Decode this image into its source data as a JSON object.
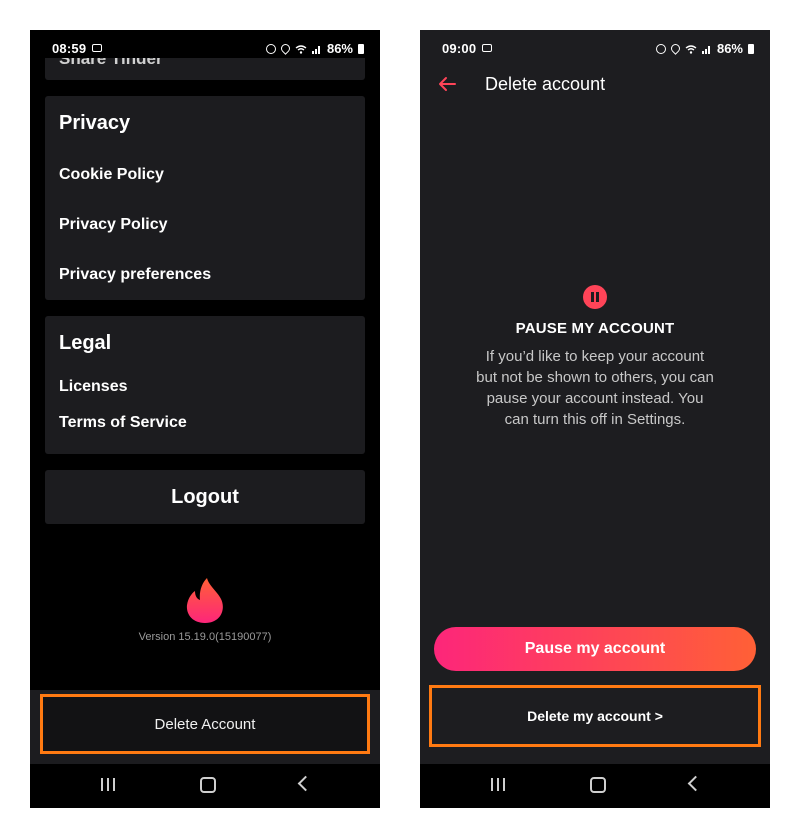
{
  "left": {
    "status": {
      "time": "08:59",
      "battery": "86%"
    },
    "share_partial": "Share Tinder",
    "privacy": {
      "title": "Privacy",
      "items": [
        "Cookie Policy",
        "Privacy Policy",
        "Privacy preferences"
      ]
    },
    "legal": {
      "title": "Legal",
      "items": [
        "Licenses",
        "Terms of Service"
      ]
    },
    "logout_label": "Logout",
    "version": "Version 15.19.0(15190077)",
    "delete_account_label": "Delete Account"
  },
  "right": {
    "status": {
      "time": "09:00",
      "battery": "86%"
    },
    "header_title": "Delete account",
    "pause_heading": "PAUSE MY ACCOUNT",
    "pause_body": "If you’d like to keep your account but not be shown to others, you can pause your account instead. You can turn this off in Settings.",
    "pause_button_label": "Pause my account",
    "delete_button_label": "Delete my account >"
  },
  "colors": {
    "accent_orange": "#ff7a12",
    "brand_pink": "#fd267a",
    "brand_orange": "#ff6036",
    "brand_red": "#ff4458"
  },
  "icons": [
    "image-icon",
    "alarm-icon",
    "location-icon",
    "wifi-icon",
    "signal-icon",
    "battery-icon",
    "flame-logo",
    "back-arrow-icon",
    "pause-icon",
    "recents-icon",
    "home-icon",
    "nav-back-icon"
  ]
}
